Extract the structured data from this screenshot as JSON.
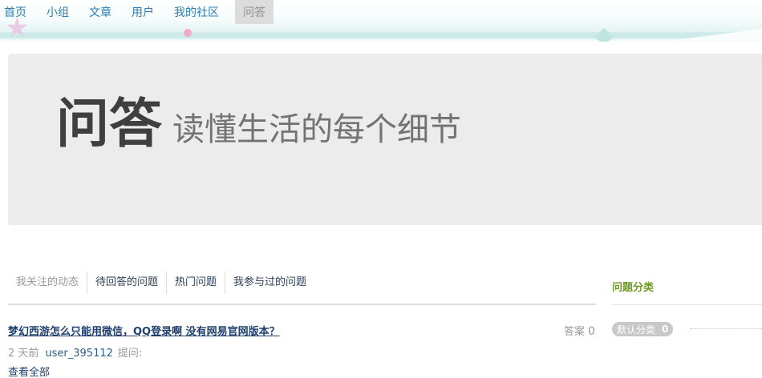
{
  "nav": {
    "items": [
      {
        "label": "首页"
      },
      {
        "label": "小组"
      },
      {
        "label": "文章"
      },
      {
        "label": "用户"
      },
      {
        "label": "我的社区"
      },
      {
        "label": "问答"
      }
    ],
    "active_index": 5
  },
  "hero": {
    "title": "问答",
    "subtitle": "读懂生活的每个细节"
  },
  "tabs": {
    "items": [
      {
        "label": "我关注的动态"
      },
      {
        "label": "待回答的问题"
      },
      {
        "label": "热门问题"
      },
      {
        "label": "我参与过的问题"
      }
    ],
    "active_index": 0
  },
  "questions": [
    {
      "title": "梦幻西游怎么只能用微信，QQ登录啊 没有网易官网版本？",
      "answers_label": "答案",
      "answers_count": "0",
      "time": "2 天前",
      "user": "user_395112",
      "action": "提问:",
      "view_all": "查看全部"
    }
  ],
  "sidebar": {
    "title": "问题分类",
    "categories": [
      {
        "name": "默认分类",
        "count": "0"
      }
    ]
  },
  "colors": {
    "link": "#2a7fb0",
    "nav_active_bg": "#dcdcdc",
    "hero_bg": "#ececec",
    "sidebar_title": "#6a9a1f",
    "badge_bg": "#c8c8c8"
  }
}
